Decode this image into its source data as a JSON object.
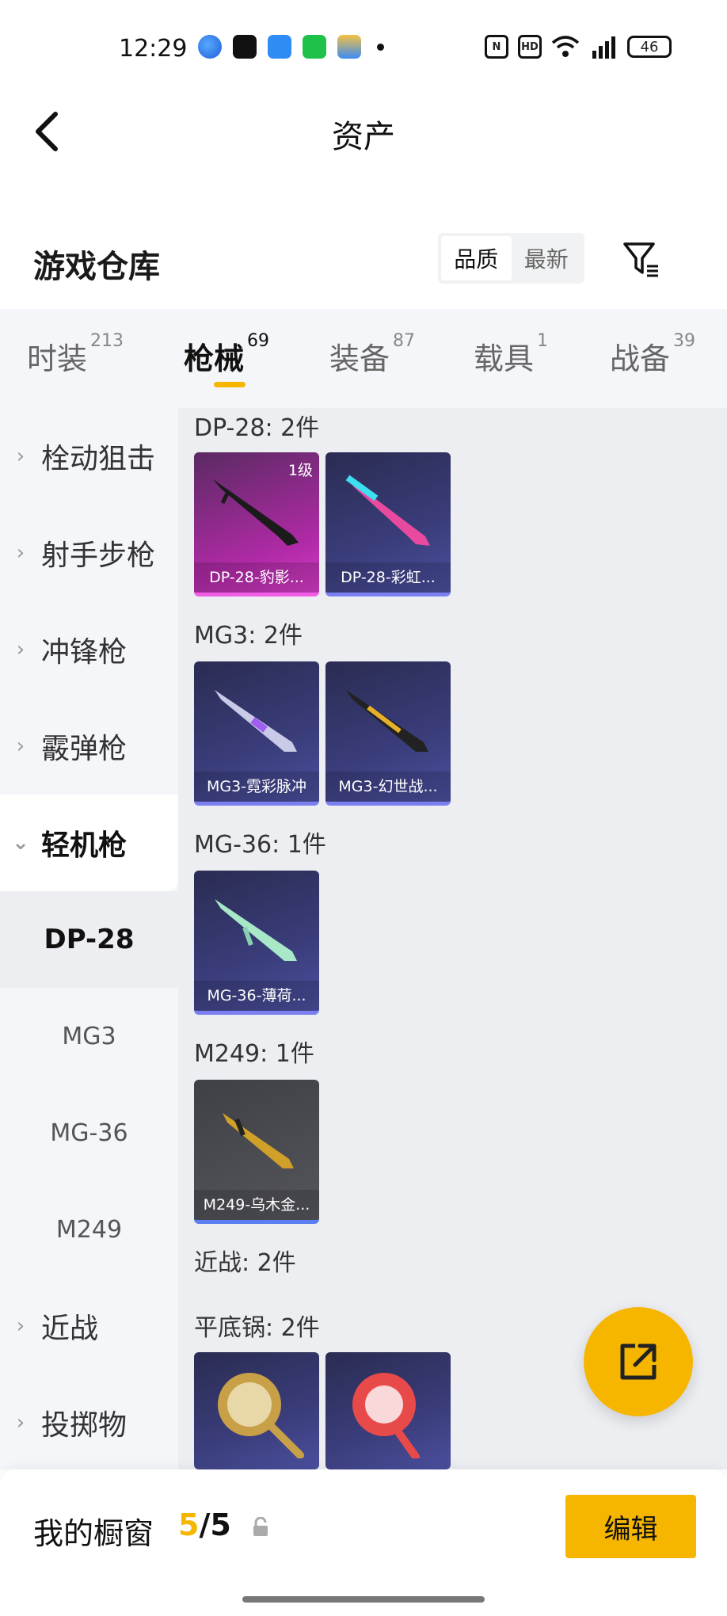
{
  "status_bar": {
    "time": "12:29",
    "battery": "46",
    "app_icons": [
      "browser-icon",
      "tiktok-icon",
      "files-icon",
      "wechat-icon",
      "wallet-icon"
    ]
  },
  "header": {
    "title": "资产"
  },
  "warehouse": {
    "label": "游戏仓库",
    "sort_options": [
      "品质",
      "最新"
    ],
    "active_sort": "品质"
  },
  "tabs": [
    {
      "label": "时装",
      "count": "213"
    },
    {
      "label": "枪械",
      "count": "69"
    },
    {
      "label": "装备",
      "count": "87"
    },
    {
      "label": "载具",
      "count": "1"
    },
    {
      "label": "战备",
      "count": "39"
    }
  ],
  "sidebar": {
    "categories": [
      "栓动狙击",
      "射手步枪",
      "冲锋枪",
      "霰弹枪",
      "轻机枪",
      "近战",
      "投掷物"
    ],
    "subitems": [
      "DP-28",
      "MG3",
      "MG-36",
      "M249"
    ],
    "selected_subitem": "DP-28"
  },
  "groups": [
    {
      "label": "DP-28: 2件",
      "items": [
        {
          "name": "DP-28-豹影...",
          "level": "1级"
        },
        {
          "name": "DP-28-彩虹..."
        }
      ]
    },
    {
      "label": "MG3: 2件",
      "items": [
        {
          "name": "MG3-霓彩脉冲"
        },
        {
          "name": "MG3-幻世战..."
        }
      ]
    },
    {
      "label": "MG-36: 1件",
      "items": [
        {
          "name": "MG-36-薄荷..."
        }
      ]
    },
    {
      "label": "M249: 1件",
      "items": [
        {
          "name": "M249-乌木金..."
        }
      ]
    },
    {
      "label": "近战: 2件",
      "items": []
    },
    {
      "label": "平底锅: 2件",
      "items": []
    }
  ],
  "showcase": {
    "label": "我的橱窗",
    "current": "5",
    "separator": "/",
    "total": "5",
    "edit_label": "编辑"
  },
  "colors": {
    "accent": "#f6b600"
  }
}
